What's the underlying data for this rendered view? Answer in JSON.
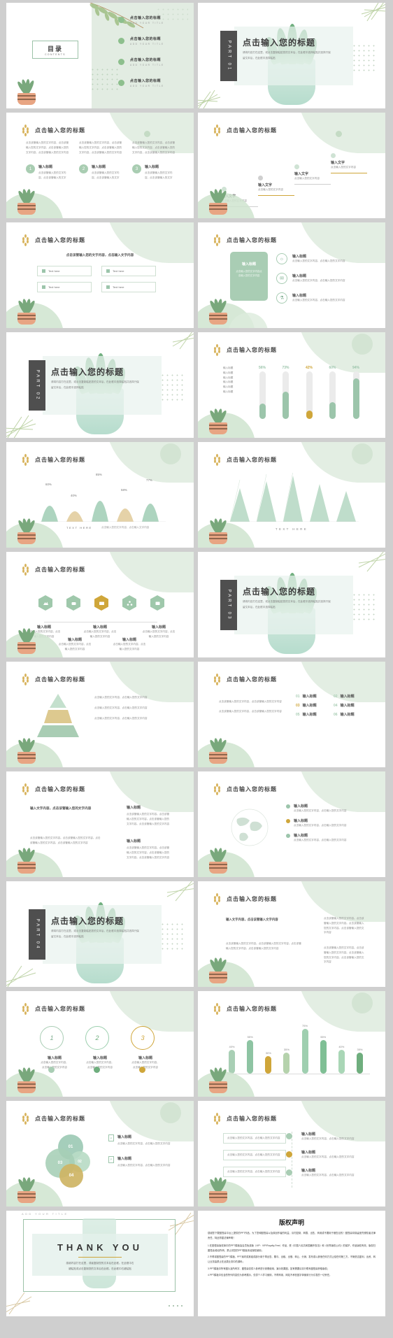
{
  "theme": {
    "green": "#8cb99a",
    "green_dark": "#6fae7e",
    "gold": "#cfa63a",
    "mint_bg": "#e2ece2",
    "dark_tab": "#4f4f4f",
    "page_bg": "#cfcfcf"
  },
  "common": {
    "title": "点击输入您的标题",
    "subtitle_cn": "输入标题",
    "body_short": "点击输入您的文字内容，点击输入您的文字内容",
    "body_line": "点击该管输入您的文字内容，",
    "para4": "点击该管输入您的文字内容。点击该管输入您的文字内容。点击该管输入您的文字内容。点击该管输入您的文字内容",
    "add_your_title": "ADD YOUR TITLE",
    "text_here": "TEXT HERE",
    "input_text": "输入文字"
  },
  "slides": [
    {
      "id": "toc",
      "title_cn": "目录",
      "title_en": "CONTENTS",
      "items": [
        {
          "cn": "点击输入您的标题",
          "en": "ADD YOUR TITLE"
        },
        {
          "cn": "点击输入您的标题",
          "en": "ADD YOUR TITLE"
        },
        {
          "cn": "点击输入您的标题",
          "en": "ADD YOUR TITLE"
        },
        {
          "cn": "点击输入您的标题",
          "en": "ADD YOUR TITLE"
        }
      ]
    },
    {
      "id": "part01",
      "tab": "PART 01",
      "heading": "点击输入您的标题",
      "desc": "请将内容打在这里，或点击复制粘贴您的文本后，在此框中选择粘贴并选择只保留文本后，在此框中选择粘贴"
    },
    {
      "id": "three-col",
      "title": "点击输入您的标题",
      "columns": [
        {
          "num": "1",
          "label": "输入标题",
          "para": "点击该管输入您的文字内容，点击该管输入您的文字内容，点击该管输入您的文字内容，点击该管输入您的文字内容",
          "sub": "点击该管输入您的文字内容，点击该管输入的文字"
        },
        {
          "num": "2",
          "label": "输入标题",
          "para": "点击该管输入您的文字内容，点击该管输入您的文字内容，点击该管输入您的文字内容，点击该管输入您的文字内容",
          "sub": "点击该管输入您的文字内容，点击该管输入的文字"
        },
        {
          "num": "3",
          "label": "输入标题",
          "para": "点击该管输入您的文字内容，点击该管输入您的文字内容，点击该管输入您的文字内容，点击该管输入您的文字内容",
          "sub": "点击该管输入您的文字内容，点击该管输入的文字"
        }
      ]
    },
    {
      "id": "stair-steps",
      "title": "点击输入您的标题",
      "steps": [
        {
          "label": "输入文字",
          "desc": "点击输入您的文字内容"
        },
        {
          "label": "输入文字",
          "desc": "点击输入您的文字内容"
        },
        {
          "label": "输入文字",
          "desc": "点击输入您的文字内容"
        },
        {
          "label": "输入文字",
          "desc": "点击输入您的文字内容"
        }
      ]
    },
    {
      "id": "four-cards",
      "title": "点击输入您的标题",
      "lead": "点击该管输入您的文字内容，点击输入文字内容",
      "cards": [
        "Text here",
        "Text here",
        "Text here",
        "Text here"
      ]
    },
    {
      "id": "panel-list",
      "title": "点击输入您的标题",
      "panel_title": "输入标题",
      "panel_desc": "点击输入您的文字内容点击输入您的文字内容",
      "rows": [
        {
          "icon": "bulb-icon",
          "label": "输入标题",
          "desc": "点击输入您的文字内容，点击输入您的文字内容"
        },
        {
          "icon": "mail-icon",
          "label": "输入标题",
          "desc": "点击输入您的文字内容，点击输入您的文字内容"
        },
        {
          "icon": "flask-icon",
          "label": "输入标题",
          "desc": "点击输入您的文字内容，点击输入您的文字内容"
        }
      ]
    },
    {
      "id": "part02",
      "tab": "PART 02",
      "heading": "点击输入您的标题",
      "desc": "请将内容打在这里，或点击复制粘贴您的文本后，在此框中选择粘贴并选择只保留文本后，在此框中选择粘贴"
    },
    {
      "id": "tube-bars",
      "title": "点击输入您的标题",
      "row_labels": [
        "输入标题",
        "输入标题",
        "输入标题",
        "输入标题",
        "输入标题",
        "输入标题"
      ]
    },
    {
      "id": "bell-curves",
      "title": "点击输入您的标题",
      "footer_left": "TEXT HERE",
      "footer_right": "点击输入您的文字内容，点击输入文字内容"
    },
    {
      "id": "triangles",
      "title": "点击输入您的标题",
      "footer": "TEXT HERE"
    },
    {
      "id": "hex-timeline",
      "title": "点击输入您的标题",
      "nodes": [
        {
          "label": "输入标题",
          "desc": "点击输入您的文字内容，点击输入您的文字内容"
        },
        {
          "label": "输入标题",
          "desc": "点击输入您的文字内容，点击输入您的文字内容"
        },
        {
          "label": "输入标题",
          "desc": "点击输入您的文字内容，点击输入您的文字内容"
        },
        {
          "label": "输入标题",
          "desc": "点击输入您的文字内容，点击输入您的文字内容"
        },
        {
          "label": "输入标题",
          "desc": "点击输入您的文字内容，点击输入您的文字内容"
        }
      ]
    },
    {
      "id": "part03",
      "tab": "PART 03",
      "heading": "点击输入您的标题",
      "desc": "请将内容打在这里，或点击复制粘贴您的文本后，在此框中选择粘贴并选择只保留文本后，在此框中选择粘贴"
    },
    {
      "id": "pyramid",
      "title": "点击输入您的标题"
    },
    {
      "id": "grid-cards",
      "title": "点击输入您的标题",
      "lead": "点击该管输入您的文字内容，点击该管输入您的文字内容"
    },
    {
      "id": "two-col-text",
      "title": "点击输入您的标题",
      "heading": "输入文字内容，点击该管输入您的文字内容",
      "side_label": "输入标题"
    },
    {
      "id": "map-list",
      "title": "点击输入您的标题"
    },
    {
      "id": "part04",
      "tab": "PART 04",
      "heading": "点击输入您的标题",
      "desc": "请将内容打在这里，或点击复制粘贴您的文本后，在此框中选择粘贴并选择只保留文本后，在此框中选择粘贴"
    },
    {
      "id": "text-blocks",
      "title": "点击输入您的标题",
      "heading": "输入文字内容，点击该管输入文字内容"
    },
    {
      "id": "rings",
      "title": "点击输入您的标题"
    },
    {
      "id": "rounded-bars",
      "title": "点击输入您的标题"
    },
    {
      "id": "venn",
      "title": "点击输入您的标题"
    },
    {
      "id": "center-list",
      "title": "点击输入您的标题"
    },
    {
      "id": "thankyou",
      "top_label": "ADD YOUR TITLE",
      "thanks": "THANK YOU",
      "desc1": "感谢内容打在这里，或者复制您的文本后在此框。在此框中右",
      "desc2": "键粘贴或点击复制您的文本后在此框。在此框中右键粘贴"
    }
  ],
  "chart_data": [
    {
      "type": "bar",
      "id": "tube-bars",
      "title": "点击输入您的标题",
      "categories": [
        "输入标题",
        "输入标题",
        "输入标题",
        "输入标题",
        "输入标题"
      ],
      "values": [
        56,
        73,
        42,
        60,
        94
      ],
      "labels": [
        "56%",
        "73%",
        "42%",
        "60%",
        "94%"
      ],
      "colors": [
        "#9cc5ab",
        "#9cc5ab",
        "#cfa63a",
        "#9cc5ab",
        "#9cc5ab"
      ],
      "ylim": [
        0,
        100
      ],
      "ylabel": "",
      "xlabel": "",
      "row_labels": [
        "输入标题",
        "输入标题",
        "输入标题",
        "输入标题",
        "输入标题",
        "输入标题"
      ]
    },
    {
      "type": "area",
      "id": "bell-curves",
      "title": "点击输入您的标题",
      "categories": [
        "",
        "",
        "",
        "",
        ""
      ],
      "values": [
        60,
        40,
        85,
        58,
        77
      ],
      "labels": [
        "60%",
        "40%",
        "85%",
        "58%",
        "77%"
      ],
      "colors": [
        "#9fcdb4",
        "#e2cd9e",
        "#9fcdb4",
        "#e2cd9e",
        "#9fcdb4"
      ],
      "ylim": [
        0,
        100
      ],
      "footer_left": "TEXT HERE",
      "footer_right": "点击输入您的文字内容，点击输入文字内容"
    },
    {
      "type": "bar",
      "id": "triangles",
      "title": "点击输入您的标题",
      "categories": [
        "",
        "",
        "",
        "",
        ""
      ],
      "values": [
        55,
        70,
        88,
        62,
        45
      ],
      "labels": [
        "",
        "",
        "",
        "",
        ""
      ],
      "colors": [
        "#b5d8c2",
        "#b5d8c2",
        "#b5d8c2",
        "#b5d8c2",
        "#b5d8c2"
      ],
      "ylim": [
        0,
        100
      ],
      "footer": "TEXT HERE"
    },
    {
      "type": "bar",
      "id": "rounded-bars",
      "title": "点击输入您的标题",
      "categories": [
        "",
        "",
        "",
        "",
        "",
        "",
        "",
        ""
      ],
      "values": [
        40,
        55,
        30,
        35,
        75,
        55,
        40,
        35
      ],
      "labels": [
        "40%",
        "55%",
        "30%",
        "35%",
        "75%",
        "55%",
        "40%",
        "35%"
      ],
      "colors": [
        "#a9cfb5",
        "#8ec4a3",
        "#cfa63a",
        "#b5d2ac",
        "#9fcfb0",
        "#7fbf95",
        "#a9d6b6",
        "#6fae7e"
      ],
      "ylim": [
        0,
        100
      ],
      "xlabel": "",
      "ylabel": ""
    },
    {
      "type": "pie",
      "id": "venn",
      "title": "点击输入您的标题",
      "categories": [
        "01",
        "02",
        "03",
        "04"
      ],
      "values": [
        25,
        25,
        25,
        25
      ],
      "colors": [
        "#9cc9b4",
        "#b9dcc6",
        "#a6cfb6",
        "#cfb564"
      ],
      "legend": [
        {
          "label": "输入标题",
          "desc": "点击输入您的文字内容，点击输入您的文字内容"
        },
        {
          "label": "输入标题",
          "desc": "点击输入您的文字内容，点击输入您的文字内容"
        }
      ]
    }
  ],
  "copyright": {
    "heading": "版权声明",
    "paragraphs": [
      "感谢您下载图怪兽平台上提供的PPT作品，为了您和图怪兽以及原创作者的利益，请勿复制、转载、出售、商用或不要用于贩售目的！图怪兽将保留追究侵权者法律责任，特此郑重法律声明！",
      "1.在图怪兽版权库中的PPT模板皆会员免费版（VIP：VIP/Royalty-Free）作品，受《中国人民共和国著作权法》和《世界版权公约》的保护。作品版权有效，版权归图怪兽/原创所有，禁止将您的PPT模板未经授权使用；",
      "2.不得将图怪兽的PPT模板、PPT素材或其组成部分用于再出售、赠与、出租、出借、转让、分销、发布或以其他任何方式让给任何第三方，不管是否盈利、出资、转让业务皆禁止在此类业务中的源码；",
      "3.PPT模板中所有图片及所有字、图怪兽仅供人参考进行参照使用、演示效果图，如有需要请另行联系图怪兽获取版权；",
      "4.PPT模板中包含的所列内容仅为参考展示，仅供个人学习使用，不得商用，网站不承担因字体使用行为引发的一切责任。"
    ]
  }
}
